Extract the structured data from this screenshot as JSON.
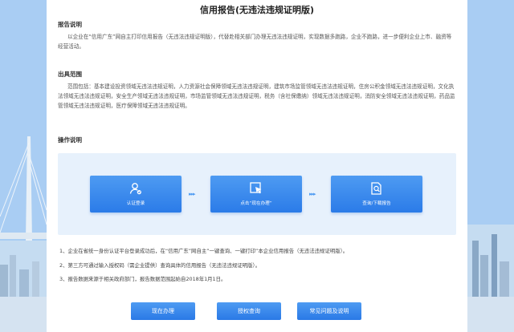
{
  "page": {
    "title": "信用报告(无违法违规证明版)"
  },
  "report_desc": {
    "heading": "报告说明",
    "text": "以企业在“信用广东”网自主打印信用报告（无违法违规证明版），代替赴相关部门办理无违法违规证明，实现数据多跑路，企业不跑路，进一步便利企业上市、融资等经营活动。"
  },
  "scope": {
    "heading": "出具范围",
    "text": "范围包括：基本建设投资领域无违法违规证明，人力资源社会保障领域无违法违规证明，建筑市场监管领域无违法违规证明，住房公积金领域无违法违规证明，文化执法领域无违法违规证明，安全生产领域无违法违规证明，市场监管领域无违法违规证明，税务（含社保缴纳）领域无违法违规证明，消防安全领域无违法违规证明，药品监管领域无违法违规证明，医疗保障领域无违法违规证明。"
  },
  "operation": {
    "heading": "操作说明",
    "steps": [
      {
        "label": "认证登录",
        "icon": "user-check-icon"
      },
      {
        "label": "点击“现在办理”",
        "icon": "click-cursor-icon"
      },
      {
        "label": "查询/下载报告",
        "icon": "document-search-icon"
      }
    ],
    "arrow": "▸▸▸"
  },
  "notes": [
    "1、企业在省统一身份认证平台登录成功后，在“信用广东”网自主”一键查询、一键打印”本企业信用报告（无违法违规证明版）。",
    "2、第三方可通过输入授权码（需企业提供）查询具体的信用报告（无违法违规证明版）。",
    "3、报告数据来源于相关政府部门，报告数据范围起始自2018年1月1日。"
  ],
  "buttons": {
    "apply": "现在办理",
    "auth_query": "授权查询",
    "faq": "常见问题及说明"
  },
  "colors": {
    "accent": "#2b7be8",
    "flow_bg": "#e7f1fc",
    "page_bg": "#b7d6f6"
  }
}
